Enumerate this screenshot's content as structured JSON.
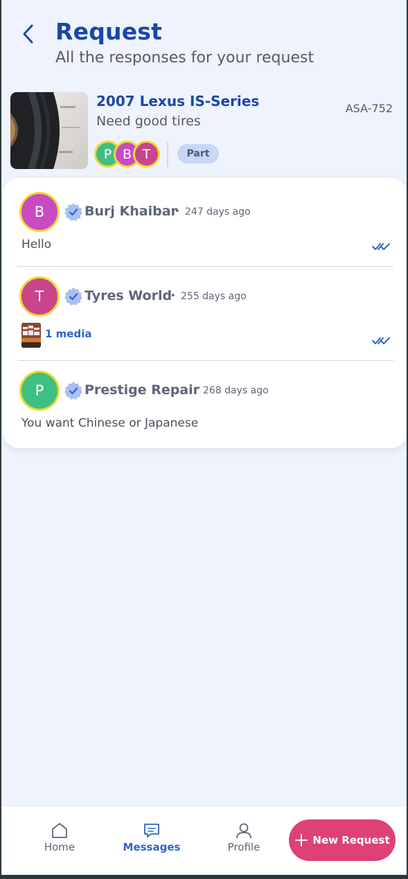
{
  "header": {
    "title": "Request",
    "subtitle": "All the responses for your request"
  },
  "request": {
    "vehicle": "2007 Lexus IS-Series",
    "description": "Need good tires",
    "reference": "ASA-752",
    "tag": "Part",
    "responder_avatars": [
      {
        "initial": "P",
        "color": "#3fbf84"
      },
      {
        "initial": "B",
        "color": "#c84bc2"
      },
      {
        "initial": "T",
        "color": "#c9458c"
      }
    ]
  },
  "responses": [
    {
      "initial": "B",
      "avatar_color": "#c84bc2",
      "name": "Burj Khaibar",
      "separator": "•",
      "time": "247 days ago",
      "message": "Hello",
      "read": true
    },
    {
      "initial": "T",
      "avatar_color": "#c9458c",
      "name": "Tyres World",
      "separator": "•",
      "time": "255 days ago",
      "media_label": "1 media",
      "read": true
    },
    {
      "initial": "P",
      "avatar_color": "#3fbf84",
      "name": "Prestige Repair",
      "separator": "•",
      "time": "268 days ago",
      "message": "You want Chinese or Japanese",
      "read": false
    }
  ],
  "nav": {
    "home": "Home",
    "messages": "Messages",
    "profile": "Profile",
    "new_request": "New Request",
    "active": "messages"
  },
  "colors": {
    "brand_blue": "#1a47a8",
    "accent_blue": "#2e63c8",
    "cta_pink": "#de4275",
    "avatar_ring": "#f2d830",
    "background": "#eef3fd"
  }
}
